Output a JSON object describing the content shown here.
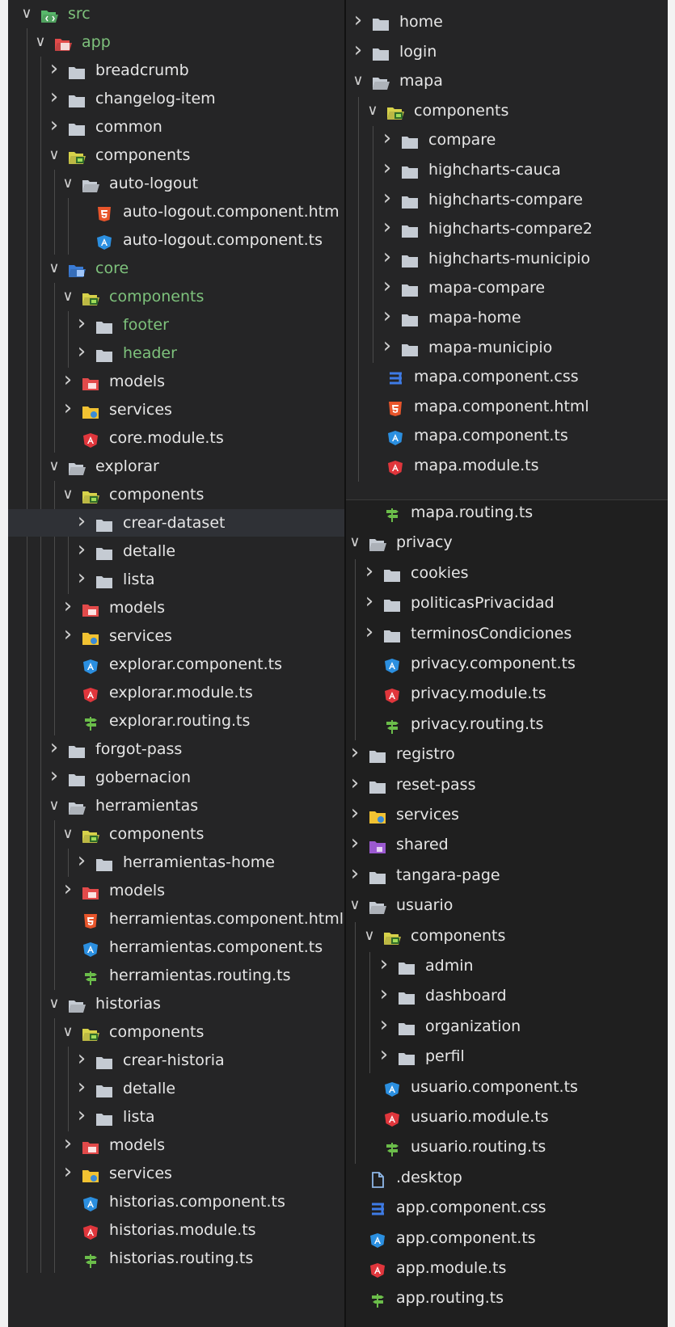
{
  "colors": {
    "folder": "#c5cbd3",
    "angular_blue": "#2b8fe0",
    "angular_red": "#e0363c",
    "html_orange": "#e8552b",
    "css_blue": "#3e7be6",
    "routing_green": "#6bbd4a",
    "git_green": "#7ec27c"
  },
  "left": [
    {
      "label": "src",
      "depth": 0,
      "expanded": true,
      "icon": "src-folder-icon",
      "green": true
    },
    {
      "label": "app",
      "depth": 1,
      "expanded": true,
      "icon": "app-folder-icon",
      "green": true
    },
    {
      "label": "breadcrumb",
      "depth": 2,
      "expanded": false,
      "icon": "folder-icon"
    },
    {
      "label": "changelog-item",
      "depth": 2,
      "expanded": false,
      "icon": "folder-icon"
    },
    {
      "label": "common",
      "depth": 2,
      "expanded": false,
      "icon": "folder-icon"
    },
    {
      "label": "components",
      "depth": 2,
      "expanded": true,
      "icon": "components-folder-icon"
    },
    {
      "label": "auto-logout",
      "depth": 3,
      "expanded": true,
      "icon": "folder-open-icon"
    },
    {
      "label": "auto-logout.component.htm",
      "depth": 4,
      "icon": "html-file-icon"
    },
    {
      "label": "auto-logout.component.ts",
      "depth": 4,
      "icon": "angular-component-icon"
    },
    {
      "label": "core",
      "depth": 2,
      "expanded": true,
      "icon": "core-folder-icon",
      "green": true
    },
    {
      "label": "components",
      "depth": 3,
      "expanded": true,
      "icon": "components-folder-icon",
      "green": true
    },
    {
      "label": "footer",
      "depth": 4,
      "expanded": false,
      "icon": "folder-icon",
      "green": true
    },
    {
      "label": "header",
      "depth": 4,
      "expanded": false,
      "icon": "folder-icon",
      "green": true
    },
    {
      "label": "models",
      "depth": 3,
      "expanded": false,
      "icon": "models-folder-icon"
    },
    {
      "label": "services",
      "depth": 3,
      "expanded": false,
      "icon": "services-folder-icon"
    },
    {
      "label": "core.module.ts",
      "depth": 3,
      "icon": "angular-module-icon"
    },
    {
      "label": "explorar",
      "depth": 2,
      "expanded": true,
      "icon": "folder-open-icon"
    },
    {
      "label": "components",
      "depth": 3,
      "expanded": true,
      "icon": "components-folder-icon"
    },
    {
      "label": "crear-dataset",
      "depth": 4,
      "expanded": false,
      "icon": "folder-icon",
      "selected": true
    },
    {
      "label": "detalle",
      "depth": 4,
      "expanded": false,
      "icon": "folder-icon"
    },
    {
      "label": "lista",
      "depth": 4,
      "expanded": false,
      "icon": "folder-icon"
    },
    {
      "label": "models",
      "depth": 3,
      "expanded": false,
      "icon": "models-folder-icon"
    },
    {
      "label": "services",
      "depth": 3,
      "expanded": false,
      "icon": "services-folder-icon"
    },
    {
      "label": "explorar.component.ts",
      "depth": 3,
      "icon": "angular-component-icon"
    },
    {
      "label": "explorar.module.ts",
      "depth": 3,
      "icon": "angular-module-icon"
    },
    {
      "label": "explorar.routing.ts",
      "depth": 3,
      "icon": "routing-file-icon"
    },
    {
      "label": "forgot-pass",
      "depth": 2,
      "expanded": false,
      "icon": "folder-icon"
    },
    {
      "label": "gobernacion",
      "depth": 2,
      "expanded": false,
      "icon": "folder-icon"
    },
    {
      "label": "herramientas",
      "depth": 2,
      "expanded": true,
      "icon": "folder-open-icon"
    },
    {
      "label": "components",
      "depth": 3,
      "expanded": true,
      "icon": "components-folder-icon"
    },
    {
      "label": "herramientas-home",
      "depth": 4,
      "expanded": false,
      "icon": "folder-icon"
    },
    {
      "label": "models",
      "depth": 3,
      "expanded": false,
      "icon": "models-folder-icon"
    },
    {
      "label": "herramientas.component.html",
      "depth": 3,
      "icon": "html-file-icon"
    },
    {
      "label": "herramientas.component.ts",
      "depth": 3,
      "icon": "angular-component-icon"
    },
    {
      "label": "herramientas.routing.ts",
      "depth": 3,
      "icon": "routing-file-icon"
    },
    {
      "label": "historias",
      "depth": 2,
      "expanded": true,
      "icon": "folder-open-icon"
    },
    {
      "label": "components",
      "depth": 3,
      "expanded": true,
      "icon": "components-folder-icon"
    },
    {
      "label": "crear-historia",
      "depth": 4,
      "expanded": false,
      "icon": "folder-icon"
    },
    {
      "label": "detalle",
      "depth": 4,
      "expanded": false,
      "icon": "folder-icon"
    },
    {
      "label": "lista",
      "depth": 4,
      "expanded": false,
      "icon": "folder-icon"
    },
    {
      "label": "models",
      "depth": 3,
      "expanded": false,
      "icon": "models-folder-icon"
    },
    {
      "label": "services",
      "depth": 3,
      "expanded": false,
      "icon": "services-folder-icon"
    },
    {
      "label": "historias.component.ts",
      "depth": 3,
      "icon": "angular-component-icon"
    },
    {
      "label": "historias.module.ts",
      "depth": 3,
      "icon": "angular-module-icon"
    },
    {
      "label": "historias.routing.ts",
      "depth": 3,
      "icon": "routing-file-icon"
    }
  ],
  "right_top": [
    {
      "label": "home",
      "depth": 0,
      "expanded": false,
      "icon": "folder-icon"
    },
    {
      "label": "login",
      "depth": 0,
      "expanded": false,
      "icon": "folder-icon"
    },
    {
      "label": "mapa",
      "depth": 0,
      "expanded": true,
      "icon": "folder-open-icon"
    },
    {
      "label": "components",
      "depth": 1,
      "expanded": true,
      "icon": "components-folder-icon"
    },
    {
      "label": "compare",
      "depth": 2,
      "expanded": false,
      "icon": "folder-icon"
    },
    {
      "label": "highcharts-cauca",
      "depth": 2,
      "expanded": false,
      "icon": "folder-icon"
    },
    {
      "label": "highcharts-compare",
      "depth": 2,
      "expanded": false,
      "icon": "folder-icon"
    },
    {
      "label": "highcharts-compare2",
      "depth": 2,
      "expanded": false,
      "icon": "folder-icon"
    },
    {
      "label": "highcharts-municipio",
      "depth": 2,
      "expanded": false,
      "icon": "folder-icon"
    },
    {
      "label": "mapa-compare",
      "depth": 2,
      "expanded": false,
      "icon": "folder-icon"
    },
    {
      "label": "mapa-home",
      "depth": 2,
      "expanded": false,
      "icon": "folder-icon"
    },
    {
      "label": "mapa-municipio",
      "depth": 2,
      "expanded": false,
      "icon": "folder-icon"
    },
    {
      "label": "mapa.component.css",
      "depth": 1,
      "icon": "css-file-icon"
    },
    {
      "label": "mapa.component.html",
      "depth": 1,
      "icon": "html-file-icon"
    },
    {
      "label": "mapa.component.ts",
      "depth": 1,
      "icon": "angular-component-icon"
    },
    {
      "label": "mapa.module.ts",
      "depth": 1,
      "icon": "angular-module-icon"
    }
  ],
  "right_bottom": [
    {
      "label": "mapa.routing.ts",
      "depth": 1,
      "icon": "routing-file-icon"
    },
    {
      "label": "privacy",
      "depth": 0,
      "expanded": true,
      "icon": "folder-open-icon"
    },
    {
      "label": "cookies",
      "depth": 1,
      "expanded": false,
      "icon": "folder-icon"
    },
    {
      "label": "politicasPrivacidad",
      "depth": 1,
      "expanded": false,
      "icon": "folder-icon"
    },
    {
      "label": "terminosCondiciones",
      "depth": 1,
      "expanded": false,
      "icon": "folder-icon"
    },
    {
      "label": "privacy.component.ts",
      "depth": 1,
      "icon": "angular-component-icon"
    },
    {
      "label": "privacy.module.ts",
      "depth": 1,
      "icon": "angular-module-icon"
    },
    {
      "label": "privacy.routing.ts",
      "depth": 1,
      "icon": "routing-file-icon"
    },
    {
      "label": "registro",
      "depth": 0,
      "expanded": false,
      "icon": "folder-icon"
    },
    {
      "label": "reset-pass",
      "depth": 0,
      "expanded": false,
      "icon": "folder-icon"
    },
    {
      "label": "services",
      "depth": 0,
      "expanded": false,
      "icon": "services-folder-icon"
    },
    {
      "label": "shared",
      "depth": 0,
      "expanded": false,
      "icon": "shared-folder-icon"
    },
    {
      "label": "tangara-page",
      "depth": 0,
      "expanded": false,
      "icon": "folder-icon"
    },
    {
      "label": "usuario",
      "depth": 0,
      "expanded": true,
      "icon": "folder-open-icon"
    },
    {
      "label": "components",
      "depth": 1,
      "expanded": true,
      "icon": "components-folder-icon"
    },
    {
      "label": "admin",
      "depth": 2,
      "expanded": false,
      "icon": "folder-icon"
    },
    {
      "label": "dashboard",
      "depth": 2,
      "expanded": false,
      "icon": "folder-icon"
    },
    {
      "label": "organization",
      "depth": 2,
      "expanded": false,
      "icon": "folder-icon"
    },
    {
      "label": "perfil",
      "depth": 2,
      "expanded": false,
      "icon": "folder-icon"
    },
    {
      "label": "usuario.component.ts",
      "depth": 1,
      "icon": "angular-component-icon"
    },
    {
      "label": "usuario.module.ts",
      "depth": 1,
      "icon": "angular-module-icon"
    },
    {
      "label": "usuario.routing.ts",
      "depth": 1,
      "icon": "routing-file-icon"
    },
    {
      "label": ".desktop",
      "depth": 0,
      "icon": "generic-file-icon"
    },
    {
      "label": "app.component.css",
      "depth": 0,
      "icon": "css-file-icon"
    },
    {
      "label": "app.component.ts",
      "depth": 0,
      "icon": "angular-component-icon"
    },
    {
      "label": "app.module.ts",
      "depth": 0,
      "icon": "angular-module-icon"
    },
    {
      "label": "app.routing.ts",
      "depth": 0,
      "icon": "routing-file-icon"
    }
  ]
}
